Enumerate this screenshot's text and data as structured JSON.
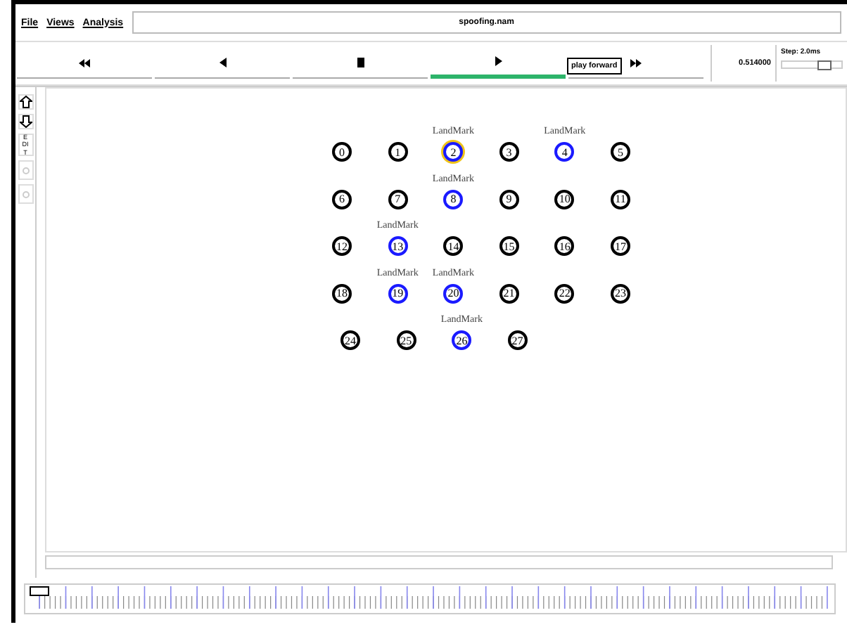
{
  "menu": [
    "File",
    "Views",
    "Analysis"
  ],
  "title": "spoofing.nam",
  "controls": [
    {
      "kind": "rewind",
      "selected": false
    },
    {
      "kind": "back",
      "selected": false
    },
    {
      "kind": "stop",
      "selected": false
    },
    {
      "kind": "play",
      "selected": true
    },
    {
      "kind": "forward",
      "selected": false
    }
  ],
  "tooltip": "play forward",
  "timeline": {
    "level": 0.0
  },
  "time": "0.514000",
  "step": {
    "label": "Step: 2.0ms",
    "level": 0.7
  },
  "tools": [
    {
      "kind": "zoom-in"
    },
    {
      "kind": "zoom-out"
    },
    {
      "kind": "edit",
      "label": "EDIT"
    },
    {
      "kind": "radio"
    },
    {
      "kind": "radio"
    }
  ],
  "node_rows": [
    [
      {
        "label": "0",
        "landmark": false,
        "highlighted": false
      },
      {
        "label": "1",
        "landmark": false,
        "highlighted": false
      },
      {
        "label": "2",
        "landmark": true,
        "tag": "LandMark",
        "highlighted": true
      },
      {
        "label": "3",
        "landmark": false,
        "highlighted": false
      },
      {
        "label": "4",
        "landmark": true,
        "tag": "LandMark",
        "highlighted": false
      },
      {
        "label": "5",
        "landmark": false,
        "highlighted": false
      }
    ],
    [
      {
        "label": "6",
        "landmark": false,
        "highlighted": false
      },
      {
        "label": "7",
        "landmark": false,
        "highlighted": false
      },
      {
        "label": "8",
        "landmark": true,
        "tag": "LandMark",
        "highlighted": false
      },
      {
        "label": "9",
        "landmark": false,
        "highlighted": false
      },
      {
        "label": "10",
        "landmark": false,
        "highlighted": false
      },
      {
        "label": "11",
        "landmark": false,
        "highlighted": false
      }
    ],
    [
      {
        "label": "12",
        "landmark": false,
        "highlighted": false
      },
      {
        "label": "13",
        "landmark": true,
        "tag": "LandMark",
        "highlighted": false
      },
      {
        "label": "14",
        "landmark": false,
        "highlighted": false
      },
      {
        "label": "15",
        "landmark": false,
        "highlighted": false
      },
      {
        "label": "16",
        "landmark": false,
        "highlighted": false
      },
      {
        "label": "17",
        "landmark": false,
        "highlighted": false
      }
    ],
    [
      {
        "label": "18",
        "landmark": false,
        "highlighted": false
      },
      {
        "label": "19",
        "landmark": true,
        "tag": "LandMark",
        "highlighted": false
      },
      {
        "label": "20",
        "landmark": true,
        "tag": "LandMark",
        "highlighted": false
      },
      {
        "label": "21",
        "landmark": false,
        "highlighted": false
      },
      {
        "label": "22",
        "landmark": false,
        "highlighted": false
      },
      {
        "label": "23",
        "landmark": false,
        "highlighted": false
      }
    ],
    [
      {
        "label": "24",
        "landmark": false,
        "highlighted": false
      },
      {
        "label": "25",
        "landmark": false,
        "highlighted": false
      },
      {
        "label": "26",
        "landmark": true,
        "tag": "LandMark",
        "highlighted": false
      },
      {
        "label": "27",
        "landmark": false,
        "highlighted": false
      }
    ]
  ]
}
